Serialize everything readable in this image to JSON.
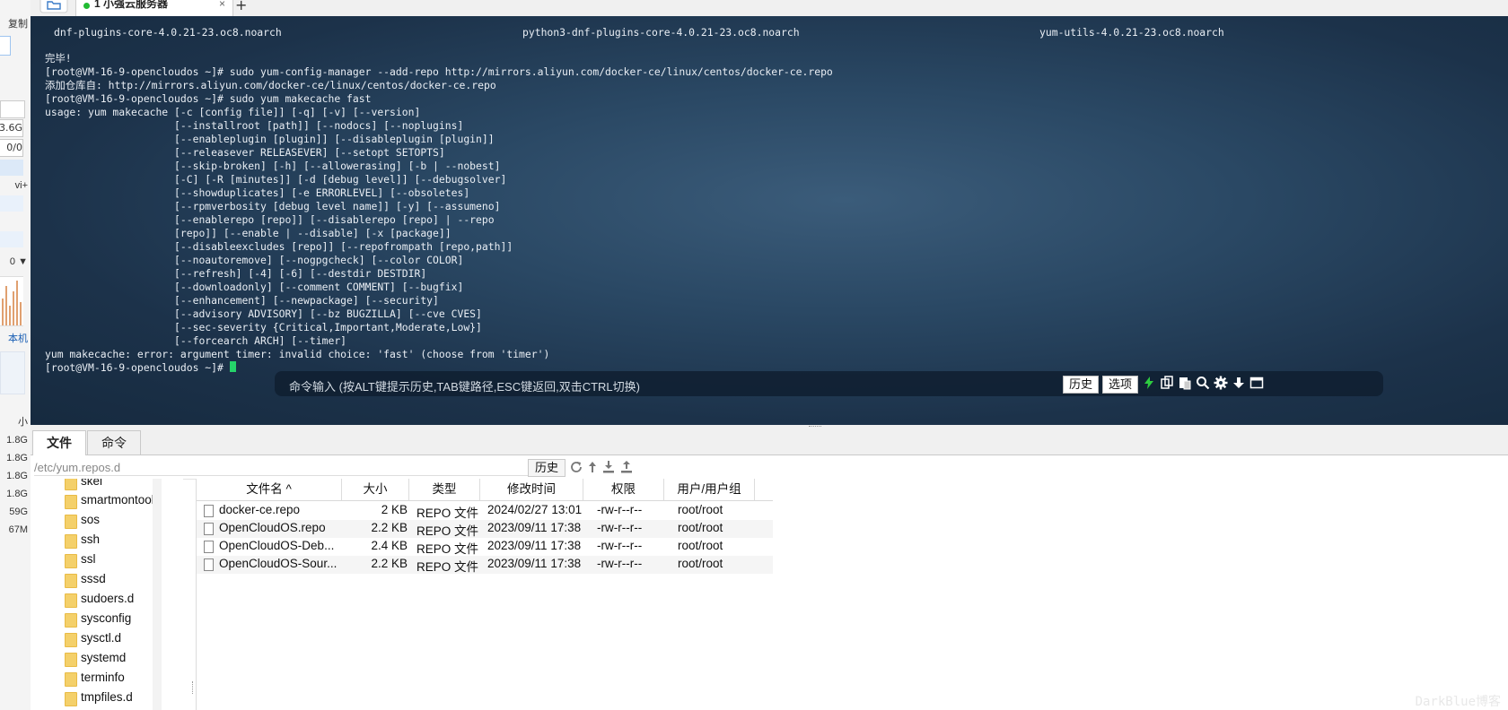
{
  "left_panel": {
    "copy_label": "复制",
    "mem_value": "3.6G",
    "swap_value": "0/0",
    "vi_label": "vi+",
    "dropdown_value": "0",
    "local_label": "本机",
    "size_header": "小",
    "sizes": [
      "1.8G",
      "1.8G",
      "1.8G",
      "1.8G",
      "59G",
      "67M"
    ]
  },
  "tabbar": {
    "tab_label": "1 小强云服务器",
    "close": "×",
    "add": "+"
  },
  "terminal": {
    "header_items": [
      "dnf-plugins-core-4.0.21-23.oc8.noarch",
      "python3-dnf-plugins-core-4.0.21-23.oc8.noarch",
      "yum-utils-4.0.21-23.oc8.noarch"
    ],
    "output": "\n\n完毕!\n[root@VM-16-9-opencloudos ~]# sudo yum-config-manager --add-repo http://mirrors.aliyun.com/docker-ce/linux/centos/docker-ce.repo\n添加仓库自: http://mirrors.aliyun.com/docker-ce/linux/centos/docker-ce.repo\n[root@VM-16-9-opencloudos ~]# sudo yum makecache fast\nusage: yum makecache [-c [config file]] [-q] [-v] [--version]\n                     [--installroot [path]] [--nodocs] [--noplugins]\n                     [--enableplugin [plugin]] [--disableplugin [plugin]]\n                     [--releasever RELEASEVER] [--setopt SETOPTS]\n                     [--skip-broken] [-h] [--allowerasing] [-b | --nobest]\n                     [-C] [-R [minutes]] [-d [debug level]] [--debugsolver]\n                     [--showduplicates] [-e ERRORLEVEL] [--obsoletes]\n                     [--rpmverbosity [debug level name]] [-y] [--assumeno]\n                     [--enablerepo [repo]] [--disablerepo [repo] | --repo\n                     [repo]] [--enable | --disable] [-x [package]]\n                     [--disableexcludes [repo]] [--repofrompath [repo,path]]\n                     [--noautoremove] [--nogpgcheck] [--color COLOR]\n                     [--refresh] [-4] [-6] [--destdir DESTDIR]\n                     [--downloadonly] [--comment COMMENT] [--bugfix]\n                     [--enhancement] [--newpackage] [--security]\n                     [--advisory ADVISORY] [--bz BUGZILLA] [--cve CVES]\n                     [--sec-severity {Critical,Important,Moderate,Low}]\n                     [--forcearch ARCH] [--timer]\nyum makecache: error: argument timer: invalid choice: 'fast' (choose from 'timer')",
    "prompt": "[root@VM-16-9-opencloudos ~]# ",
    "cursor_color": "#25d36a"
  },
  "command_bar": {
    "placeholder": "命令输入 (按ALT键提示历史,TAB键路径,ESC键返回,双击CTRL切换)",
    "history_label": "历史",
    "options_label": "选项"
  },
  "bottom_tabs": [
    "文件",
    "命令"
  ],
  "path_bar": {
    "path": "/etc/yum.repos.d",
    "history_label": "历史"
  },
  "folder_tree": [
    "skel",
    "smartmontools",
    "sos",
    "ssh",
    "ssl",
    "sssd",
    "sudoers.d",
    "sysconfig",
    "sysctl.d",
    "systemd",
    "terminfo",
    "tmpfiles.d"
  ],
  "file_table": {
    "headers": [
      "文件名 ^",
      "大小",
      "类型",
      "修改时间",
      "权限",
      "用户/用户组"
    ],
    "rows": [
      {
        "name": "docker-ce.repo",
        "size": "2 KB",
        "type": "REPO 文件",
        "mtime": "2024/02/27 13:01",
        "perm": "-rw-r--r--",
        "owner": "root/root"
      },
      {
        "name": "OpenCloudOS.repo",
        "size": "2.2 KB",
        "type": "REPO 文件",
        "mtime": "2023/09/11 17:38",
        "perm": "-rw-r--r--",
        "owner": "root/root"
      },
      {
        "name": "OpenCloudOS-Deb...",
        "size": "2.4 KB",
        "type": "REPO 文件",
        "mtime": "2023/09/11 17:38",
        "perm": "-rw-r--r--",
        "owner": "root/root"
      },
      {
        "name": "OpenCloudOS-Sour...",
        "size": "2.2 KB",
        "type": "REPO 文件",
        "mtime": "2023/09/11 17:38",
        "perm": "-rw-r--r--",
        "owner": "root/root"
      }
    ]
  },
  "watermark": "DarkBlue博客",
  "colors": {
    "terminal_bg": "#234360",
    "accent_green": "#22bb33",
    "folder": "#f4d06a"
  }
}
